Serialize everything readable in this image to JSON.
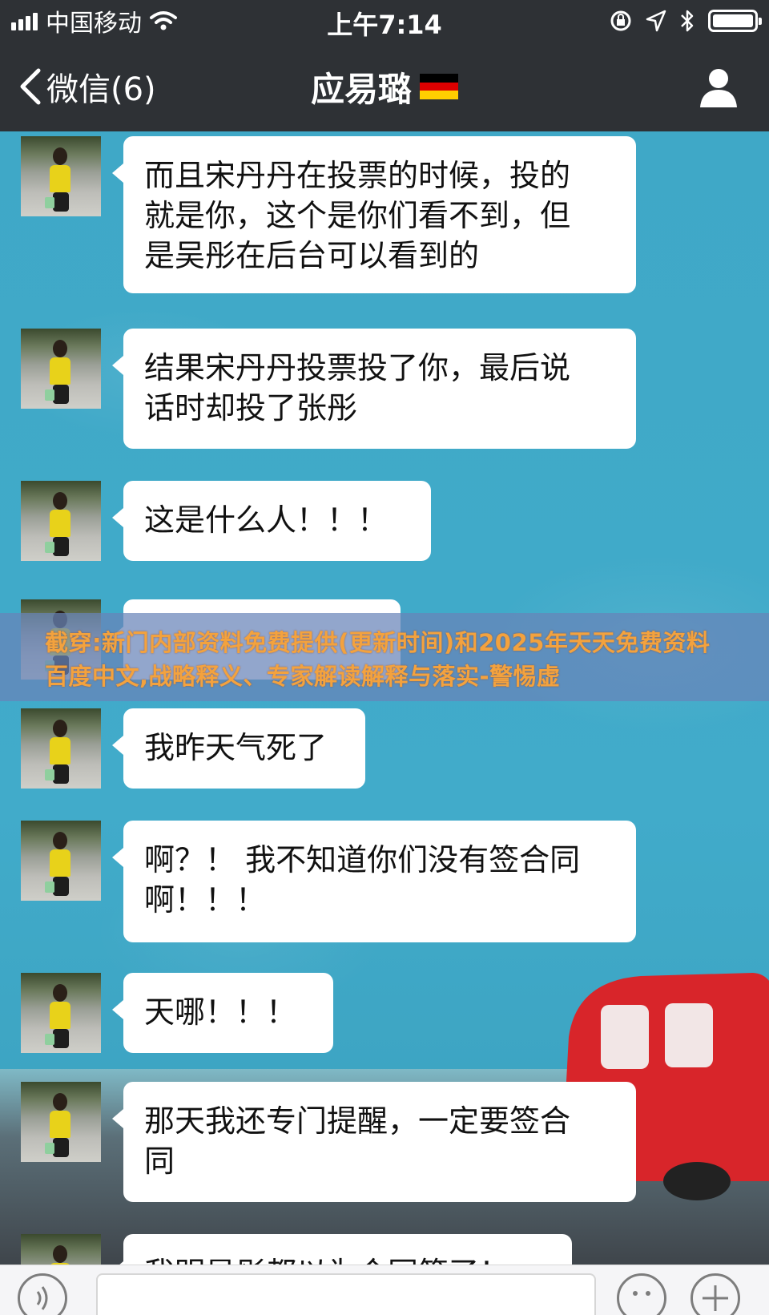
{
  "status_bar": {
    "carrier": "中国移动",
    "time": "上午7:14",
    "icons": [
      "signal-icon",
      "wifi-icon",
      "rotation-lock-icon",
      "location-icon",
      "bluetooth-icon",
      "battery-icon"
    ]
  },
  "nav": {
    "back_label": "微信(6)",
    "title": "应易璐",
    "title_flag": "germany-flag-icon",
    "right_icon": "profile-icon"
  },
  "messages": [
    {
      "sender": "incoming",
      "text": "而且宋丹丹在投票的时候，投的\n就是你，这个是你们看不到，但\n是吴彤在后台可以看到的"
    },
    {
      "sender": "incoming",
      "text": "结果宋丹丹投票投了你，最后说\n话时却投了张彤"
    },
    {
      "sender": "incoming",
      "text": "这是什么人！！！"
    },
    {
      "sender": "incoming",
      "text": ""
    },
    {
      "sender": "incoming",
      "text": "我昨天气死了"
    },
    {
      "sender": "incoming",
      "text": "啊？！ 我不知道你们没有签合同\n啊！！！"
    },
    {
      "sender": "incoming",
      "text": "天哪！！！"
    },
    {
      "sender": "incoming",
      "text": "那天我还专门提醒，一定要签合\n同"
    },
    {
      "sender": "incoming",
      "text": "我明显彤都以为合同签了！"
    }
  ],
  "banner": {
    "text": "截穿:新门内部资料免费提供(更新时间)和2025年天天免费资料百度中文,战略释义、专家解读解释与落实-警惕虚"
  },
  "input_bar": {
    "icons": [
      "voice-icon",
      "emoji-icon",
      "plus-icon"
    ]
  },
  "colors": {
    "header_bg": "#2e3135",
    "chat_bg": "#3fa7c6",
    "bubble_bg": "#ffffff",
    "banner_bg": "#6884b8",
    "banner_text": "#f3a23e"
  }
}
